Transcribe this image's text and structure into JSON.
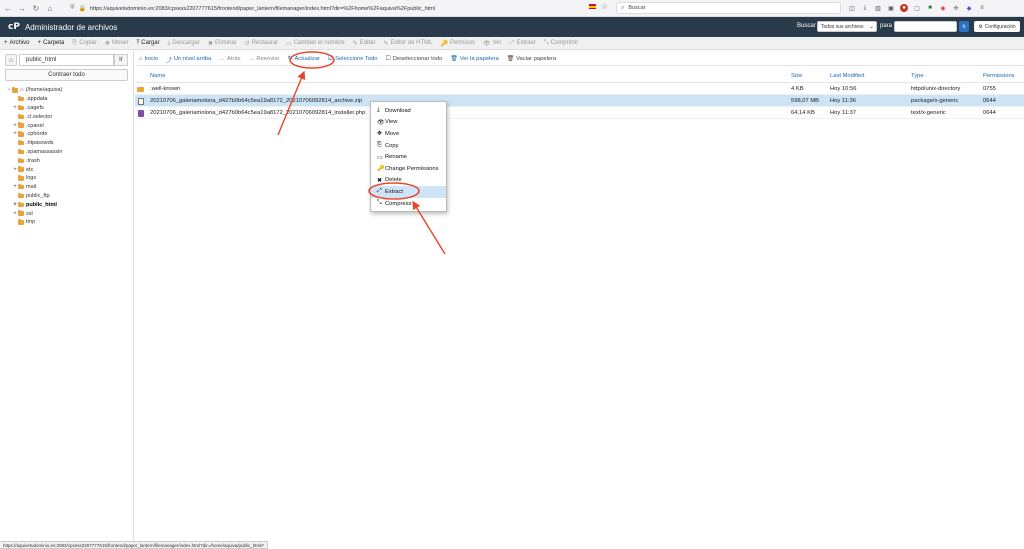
{
  "browser": {
    "url": "https://aquivetudominio.es:2083/cpsess2207777615/frontend/paper_lantern/filemanager/index.html?dir=%2Fhome%2Faquiva%2Fpublic_html",
    "search_placeholder": "Buscar"
  },
  "header": {
    "logo": "cP",
    "title": "Administrador de archivos",
    "search_label": "Buscar",
    "search_scope": "Todos sus archivos",
    "para_label": "para",
    "go_label": "Ir",
    "settings_label": "Configuración"
  },
  "toolbar": {
    "items": [
      {
        "label": "Archivo",
        "icon": "+",
        "enabled": true
      },
      {
        "label": "Carpeta",
        "icon": "+",
        "enabled": true
      },
      {
        "label": "Copiar",
        "icon": "⎘",
        "enabled": false
      },
      {
        "label": "Mover",
        "icon": "✥",
        "enabled": false
      },
      {
        "label": "Cargar",
        "icon": "⤒",
        "enabled": true
      },
      {
        "label": "Descargar",
        "icon": "⤓",
        "enabled": false
      },
      {
        "label": "Eliminar",
        "icon": "✖",
        "enabled": false
      },
      {
        "label": "Restaurar",
        "icon": "↺",
        "enabled": false
      },
      {
        "label": "Cambiar el nombre",
        "icon": "▭",
        "enabled": false
      },
      {
        "label": "Editar",
        "icon": "✎",
        "enabled": false
      },
      {
        "label": "Editor de HTML",
        "icon": "✎",
        "enabled": false
      },
      {
        "label": "Permisos",
        "icon": "🔑",
        "enabled": false
      },
      {
        "label": "Ver",
        "icon": "👁",
        "enabled": false
      },
      {
        "label": "Extraer",
        "icon": "⤢",
        "enabled": false
      },
      {
        "label": "Comprimir",
        "icon": "⤡",
        "enabled": false
      }
    ]
  },
  "sidebar": {
    "path_value": "public_html",
    "go_label": "Ir",
    "collapse_label": "Contraer todo",
    "tree": [
      {
        "label": "(/home/aquiva)",
        "toggle": "−",
        "kind": "home",
        "indent": 0,
        "bold": false
      },
      {
        "label": ".appdata",
        "toggle": "",
        "kind": "folder",
        "indent": 1,
        "bold": false
      },
      {
        "label": ".cagefs",
        "toggle": "+",
        "kind": "folder",
        "indent": 1,
        "bold": false
      },
      {
        "label": ".cl.selector",
        "toggle": "",
        "kind": "folder",
        "indent": 1,
        "bold": false
      },
      {
        "label": ".cpanel",
        "toggle": "+",
        "kind": "folder",
        "indent": 1,
        "bold": false
      },
      {
        "label": ".cphorde",
        "toggle": "+",
        "kind": "folder",
        "indent": 1,
        "bold": false
      },
      {
        "label": ".htpasswds",
        "toggle": "",
        "kind": "folder",
        "indent": 1,
        "bold": false
      },
      {
        "label": ".spamassassin",
        "toggle": "",
        "kind": "folder",
        "indent": 1,
        "bold": false
      },
      {
        "label": ".trash",
        "toggle": "",
        "kind": "folder",
        "indent": 1,
        "bold": false
      },
      {
        "label": "etc",
        "toggle": "+",
        "kind": "folder",
        "indent": 1,
        "bold": false
      },
      {
        "label": "logs",
        "toggle": "",
        "kind": "folder",
        "indent": 1,
        "bold": false
      },
      {
        "label": "mail",
        "toggle": "+",
        "kind": "folder",
        "indent": 1,
        "bold": false
      },
      {
        "label": "public_ftp",
        "toggle": "",
        "kind": "folder",
        "indent": 1,
        "bold": false
      },
      {
        "label": "public_html",
        "toggle": "+",
        "kind": "folder",
        "indent": 1,
        "bold": true
      },
      {
        "label": "ssl",
        "toggle": "+",
        "kind": "folder",
        "indent": 1,
        "bold": false
      },
      {
        "label": "tmp",
        "toggle": "",
        "kind": "folder",
        "indent": 1,
        "bold": false
      }
    ]
  },
  "actionbar": {
    "items": [
      {
        "label": "Inicio",
        "icon": "⌂",
        "style": "link"
      },
      {
        "label": "Un nivel arriba",
        "icon": "⤴",
        "style": "link"
      },
      {
        "label": "Atrás",
        "icon": "←",
        "style": "muted"
      },
      {
        "label": "Reenviar",
        "icon": "→",
        "style": "muted"
      },
      {
        "label": "Actualizar",
        "icon": "↻",
        "style": "link"
      },
      {
        "label": "Seleccione Todo",
        "icon": "☑",
        "style": "link"
      },
      {
        "label": "Deseleccionar todo",
        "icon": "☐",
        "style": "plain"
      },
      {
        "label": "Ver la papelera",
        "icon": "🗑",
        "style": "link"
      },
      {
        "label": "Vaciar papelera",
        "icon": "🗑",
        "style": "plain"
      }
    ]
  },
  "table": {
    "headers": {
      "name": "Name",
      "size": "Size",
      "modified": "Last Modified",
      "type": "Type",
      "perms": "Permissions"
    },
    "rows": [
      {
        "icon": "folder",
        "name": ".well-known",
        "size": "4 KB",
        "modified": "Hoy 10:56",
        "type": "httpd/unix-directory",
        "perms": "0755",
        "selected": false
      },
      {
        "icon": "zip",
        "name": "20210706_galeriamolona_d427b0b64c5ea19a8172_20210706092814_archive.zip",
        "size": "598,07 MB",
        "modified": "Hoy 11:36",
        "type": "package/x-generic",
        "perms": "0644",
        "selected": true
      },
      {
        "icon": "php",
        "name": "20210706_galeriamolona_d427b0b64c5ea19a8172_20210706092814_installer.php",
        "size": "64,14 KB",
        "modified": "Hoy 11:37",
        "type": "text/x-generic",
        "perms": "0644",
        "selected": false
      }
    ]
  },
  "context_menu": {
    "items": [
      {
        "label": "Download",
        "icon": "⤓",
        "active": false
      },
      {
        "label": "View",
        "icon": "👁",
        "active": false
      },
      {
        "label": "Move",
        "icon": "✥",
        "active": false
      },
      {
        "label": "Copy",
        "icon": "⎘",
        "active": false
      },
      {
        "label": "Rename",
        "icon": "▭",
        "active": false
      },
      {
        "label": "Change Permissions",
        "icon": "🔑",
        "active": false
      },
      {
        "label": "Delete",
        "icon": "✖",
        "active": false
      },
      {
        "label": "Extract",
        "icon": "⤢",
        "active": true
      },
      {
        "label": "Compress",
        "icon": "⤡",
        "active": false
      }
    ]
  },
  "status": {
    "text": "https://aquivetudominio.es:2083/cpsess2207777615/frontend/paper_lantern/filemanager/index.html?dir=/home/aquiva/public_html#"
  },
  "colors": {
    "header_bg": "#293a4a",
    "link": "#1a66b5",
    "selected_row": "#cde3f6",
    "annotation": "#e8462a"
  }
}
